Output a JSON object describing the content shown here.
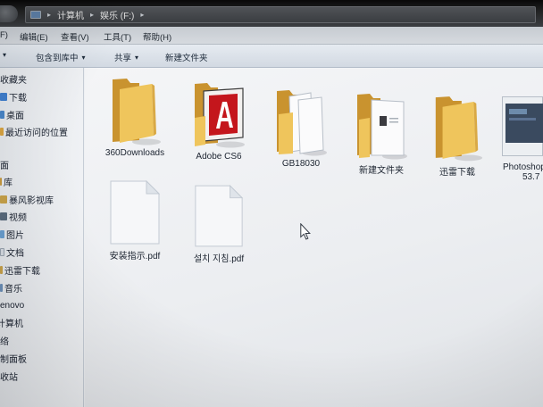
{
  "address": {
    "separator": "▸",
    "items": [
      "计算机",
      "娱乐 (F:)"
    ]
  },
  "menu": [
    {
      "label": "F)"
    },
    {
      "label": "编辑(E)"
    },
    {
      "label": "查看(V)"
    },
    {
      "label": "工具(T)"
    },
    {
      "label": "帮助(H)"
    }
  ],
  "toolbar": {
    "organize": {
      "arrow": "▾"
    },
    "include_library": {
      "label": "包含到库中",
      "arrow": "▾"
    },
    "share": {
      "label": "共享",
      "arrow": "▾"
    },
    "new_folder": {
      "label": "新建文件夹"
    }
  },
  "nav": [
    {
      "label": "收藏夹"
    },
    {
      "label": "下载",
      "icon": "download-folder-icon"
    },
    {
      "label": "桌面",
      "icon": "desktop-icon"
    },
    {
      "label": "最近访问的位置",
      "icon": "recent-places-icon"
    },
    {
      "label": "面"
    },
    {
      "label": "库",
      "icon": "library-icon"
    },
    {
      "label": "暴风影视库",
      "icon": "library-folder-icon"
    },
    {
      "label": "视频",
      "icon": "video-library-icon"
    },
    {
      "label": "图片",
      "icon": "pictures-library-icon"
    },
    {
      "label": "文档",
      "icon": "documents-library-icon"
    },
    {
      "label": "迅雷下载",
      "icon": "library-folder-icon"
    },
    {
      "label": "音乐",
      "icon": "music-library-icon"
    },
    {
      "label": "enovo"
    },
    {
      "label": "计算机"
    },
    {
      "label": "络"
    },
    {
      "label": "制面板"
    },
    {
      "label": "收站"
    }
  ],
  "files": [
    {
      "name": "360Downloads",
      "icon": "folder-icon"
    },
    {
      "name": "Adobe CS6",
      "icon": "folder-adobe-icon"
    },
    {
      "name": "GB18030",
      "icon": "folder-documents-icon"
    },
    {
      "name": "新建文件夹",
      "icon": "folder-document-icon"
    },
    {
      "name": "迅雷下载",
      "icon": "folder-icon"
    },
    {
      "name": "Photoshop",
      "name_line2": "53.7",
      "icon": "image-thumbnail-icon"
    },
    {
      "name": "安装指示.pdf",
      "icon": "pdf-document-icon"
    },
    {
      "name": "설치 지침.pdf",
      "icon": "pdf-document-icon"
    }
  ],
  "colors": {
    "folder_front": "#efc55c",
    "folder_back": "#c9932f",
    "adobe_red": "#c4161c"
  }
}
